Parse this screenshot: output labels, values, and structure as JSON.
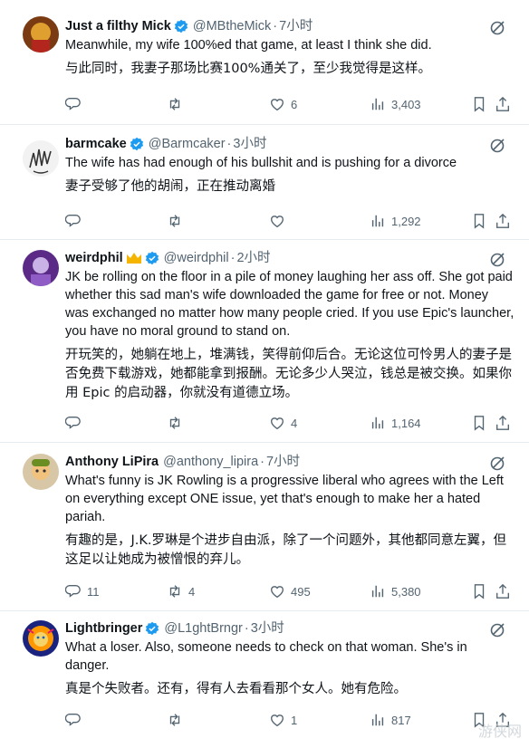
{
  "tweets": [
    {
      "name": "Just a filthy Mick",
      "handle": "@MBtheMick",
      "dot": "·",
      "time": "7小时",
      "text_en": "Meanwhile, my wife 100%ed that game, at least I think she did.",
      "text_zh": "与此同时，我妻子那场比赛100%通关了，至少我觉得是这样。",
      "replies": "",
      "retweets": "",
      "likes": "6",
      "views": "3,403"
    },
    {
      "name": "barmcake",
      "handle": "@Barmcaker",
      "dot": "·",
      "time": "3小时",
      "text_en": "The wife has had enough of his bullshit and is pushing for a divorce",
      "text_zh": "妻子受够了他的胡闹，正在推动离婚",
      "replies": "",
      "retweets": "",
      "likes": "",
      "views": "1,292"
    },
    {
      "name": "weirdphil",
      "handle": "@weirdphil",
      "dot": "·",
      "time": "2小时",
      "text_en": "JK be rolling on the floor in a pile of money laughing her ass off. She got paid whether this sad man's wife downloaded the game for free or not. Money was exchanged no matter how many people cried. If you use Epic's launcher, you have no moral ground to stand on.",
      "text_zh": "开玩笑的，她躺在地上，堆满钱，笑得前仰后合。无论这位可怜男人的妻子是否免费下载游戏，她都能拿到报酬。无论多少人哭泣，钱总是被交换。如果你用 Epic 的启动器，你就没有道德立场。",
      "replies": "",
      "retweets": "",
      "likes": "4",
      "views": "1,164"
    },
    {
      "name": "Anthony LiPira",
      "handle": "@anthony_lipira",
      "dot": "·",
      "time": "7小时",
      "text_en": "What's funny is JK Rowling is a progressive liberal who agrees with the Left on everything except ONE issue, yet that's enough to make her a hated pariah.",
      "text_zh": "有趣的是，J.K.罗琳是个进步自由派，除了一个问题外，其他都同意左翼，但这足以让她成为被憎恨的弃儿。",
      "replies": "11",
      "retweets": "4",
      "likes": "495",
      "views": "5,380"
    },
    {
      "name": "Lightbringer",
      "handle": "@L1ghtBrngr",
      "dot": "·",
      "time": "3小时",
      "text_en": "What a loser. Also, someone needs to check on that woman. She's in danger.",
      "text_zh": "真是个失败者。还有，得有人去看看那个女人。她有危险。",
      "replies": "",
      "retweets": "",
      "likes": "1",
      "views": "817"
    }
  ],
  "watermark": "游侠网",
  "colors": {
    "verified": "#1d9bf0",
    "muted": "#536471",
    "text": "#0f1419"
  }
}
